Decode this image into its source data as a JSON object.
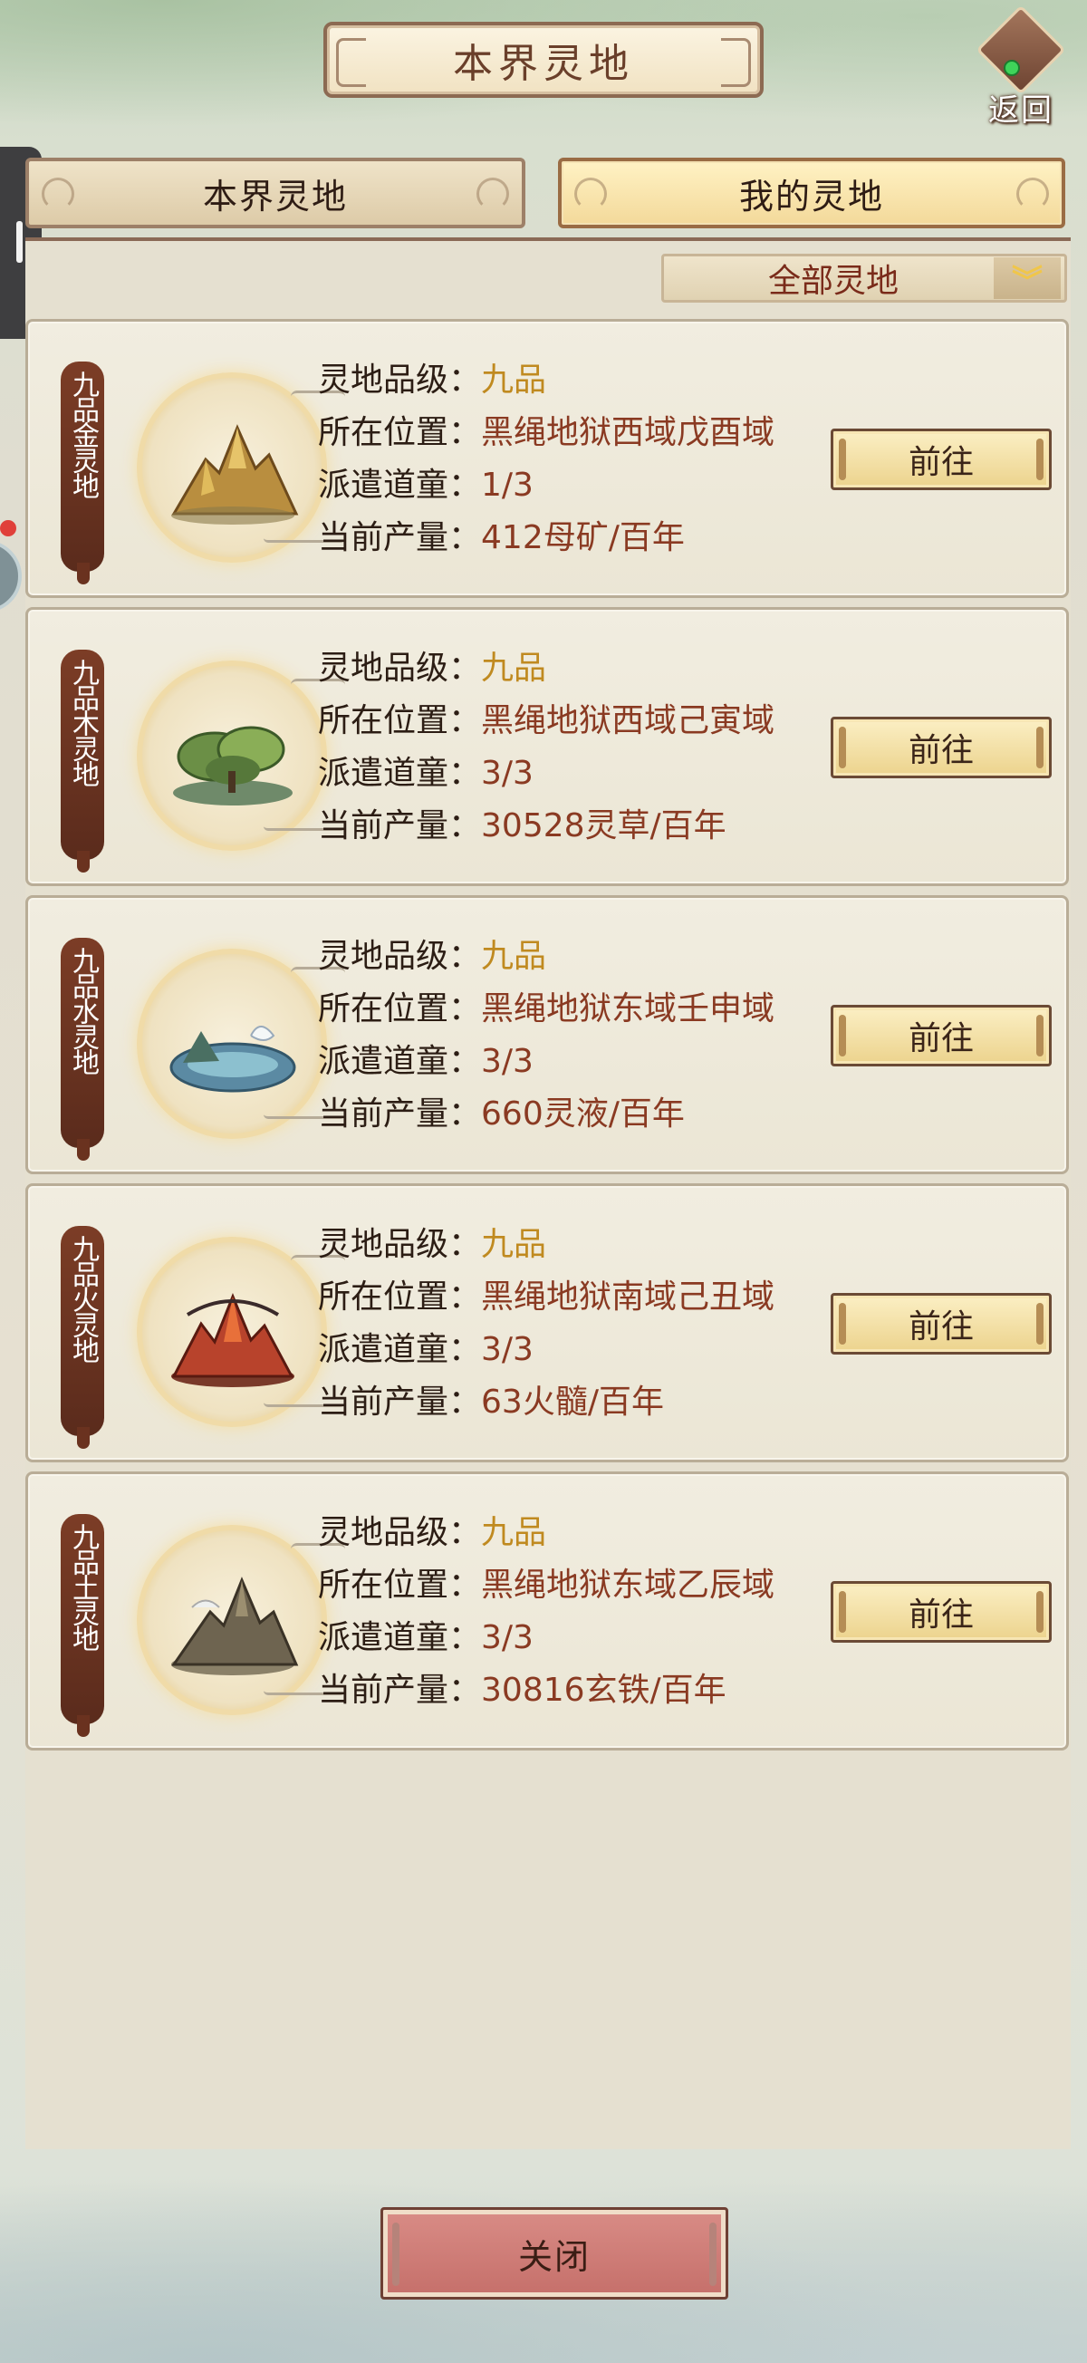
{
  "header": {
    "title": "本界灵地",
    "back_label": "返回"
  },
  "tabs": [
    {
      "label": "本界灵地",
      "active": false
    },
    {
      "label": "我的灵地",
      "active": true
    }
  ],
  "filter": {
    "selected": "全部灵地"
  },
  "field_labels": {
    "grade": "灵地品级：",
    "location": "所在位置：",
    "dispatch": "派遣道童：",
    "output": "当前产量："
  },
  "lands": [
    {
      "badge": "九品金灵地",
      "grade": "九品",
      "location": "黑绳地狱西域戊酉域",
      "dispatch": "1/3",
      "output": "412母矿/百年",
      "button": "前往",
      "icon": "golden-mountain-icon"
    },
    {
      "badge": "九品木灵地",
      "grade": "九品",
      "location": "黑绳地狱西域己寅域",
      "dispatch": "3/3",
      "output": "30528灵草/百年",
      "button": "前往",
      "icon": "forest-icon"
    },
    {
      "badge": "九品水灵地",
      "grade": "九品",
      "location": "黑绳地狱东域壬申域",
      "dispatch": "3/3",
      "output": "660灵液/百年",
      "button": "前往",
      "icon": "water-lake-icon"
    },
    {
      "badge": "九品火灵地",
      "grade": "九品",
      "location": "黑绳地狱南域己丑域",
      "dispatch": "3/3",
      "output": "63火髓/百年",
      "button": "前往",
      "icon": "volcano-icon"
    },
    {
      "badge": "九品土灵地",
      "grade": "九品",
      "location": "黑绳地狱东域乙辰域",
      "dispatch": "3/3",
      "output": "30816玄铁/百年",
      "button": "前往",
      "icon": "earth-mountain-icon"
    }
  ],
  "close_label": "关闭",
  "colors": {
    "grade": "#c08a20",
    "value": "#8a3a22",
    "accent": "#f3d99a",
    "close": "#c56f6a"
  }
}
